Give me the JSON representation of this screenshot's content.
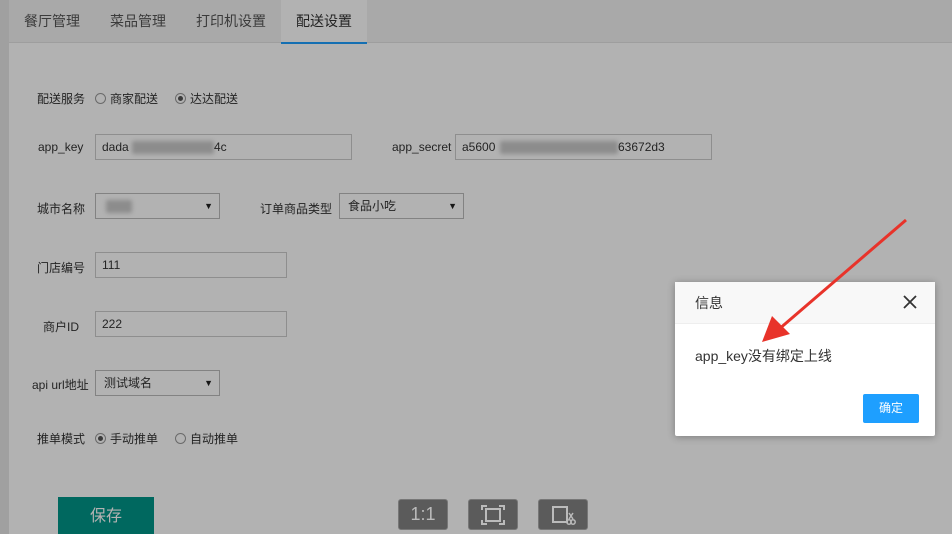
{
  "tabs": [
    {
      "label": "餐厅管理",
      "active": false
    },
    {
      "label": "菜品管理",
      "active": false
    },
    {
      "label": "打印机设置",
      "active": false
    },
    {
      "label": "配送设置",
      "active": true
    }
  ],
  "form": {
    "delivery_service": {
      "label": "配送服务",
      "options": [
        {
          "label": "商家配送",
          "selected": false
        },
        {
          "label": "达达配送",
          "selected": true
        }
      ]
    },
    "app_key": {
      "label": "app_key",
      "value_prefix": "dada",
      "value_suffix": "4c"
    },
    "app_secret": {
      "label": "app_secret",
      "value_prefix": "a5600",
      "value_suffix": "63672d3"
    },
    "city": {
      "label": "城市名称",
      "value": ""
    },
    "order_category": {
      "label": "订单商品类型",
      "value": "食品小吃"
    },
    "store_no": {
      "label": "门店编号",
      "value": "111"
    },
    "merchant_id": {
      "label": "商户ID",
      "value": "222"
    },
    "api_url": {
      "label": "api url地址",
      "value": "测试域名"
    },
    "push_mode": {
      "label": "推单模式",
      "options": [
        {
          "label": "手动推单",
          "selected": true
        },
        {
          "label": "自动推单",
          "selected": false
        }
      ]
    },
    "save_label": "保存"
  },
  "viewer": {
    "actual_size_label": "1:1"
  },
  "dialog": {
    "title": "信息",
    "message": "app_key没有绑定上线",
    "ok_label": "确定"
  },
  "colors": {
    "tab_accent": "#1e9fff",
    "save_button": "#009688",
    "dialog_button": "#1e9fff",
    "arrow": "#e8332a"
  }
}
